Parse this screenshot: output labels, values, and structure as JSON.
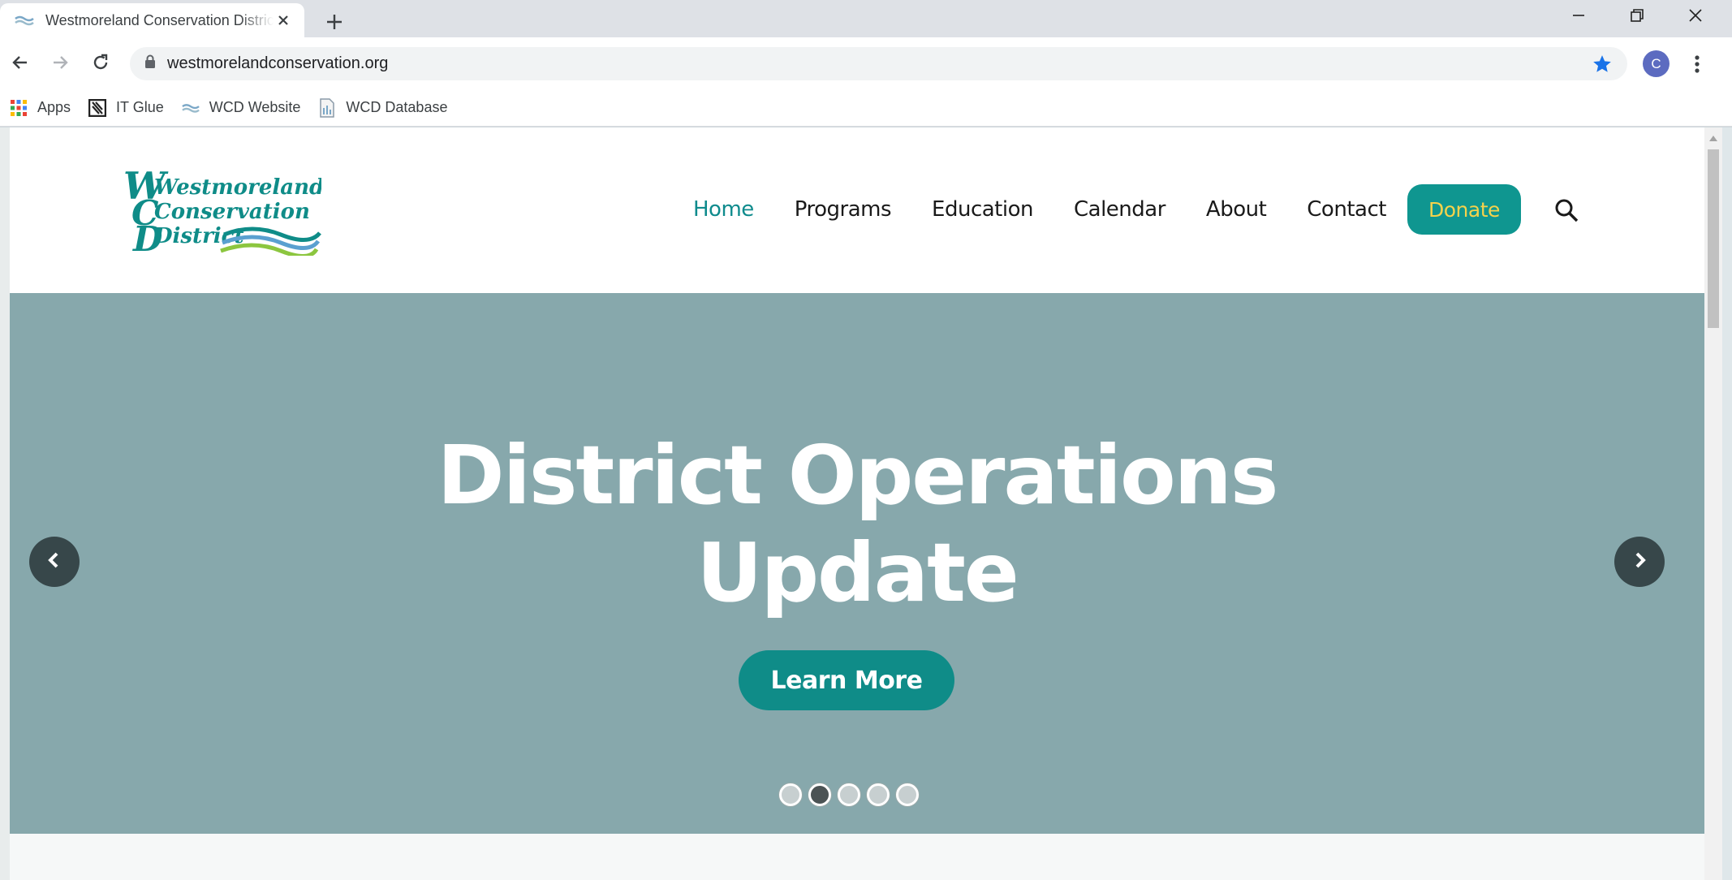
{
  "browser": {
    "tab_title": "Westmoreland Conservation District",
    "url": "westmorelandconservation.org",
    "profile_initial": "C",
    "bookmarks": [
      {
        "label": "Apps",
        "icon": "apps-grid-icon"
      },
      {
        "label": "IT Glue",
        "icon": "it-glue-icon"
      },
      {
        "label": "WCD Website",
        "icon": "wcd-favicon"
      },
      {
        "label": "WCD Database",
        "icon": "document-icon"
      }
    ]
  },
  "site": {
    "logo_lines": [
      "Westmoreland",
      "Conservation",
      "District"
    ],
    "nav": [
      {
        "label": "Home",
        "active": true
      },
      {
        "label": "Programs"
      },
      {
        "label": "Education"
      },
      {
        "label": "Calendar"
      },
      {
        "label": "About"
      },
      {
        "label": "Contact"
      }
    ],
    "donate_label": "Donate",
    "colors": {
      "teal": "#0f8c88",
      "donate_text": "#f5d24b",
      "hero_bg": "#87a8ac"
    }
  },
  "hero": {
    "title_line1": "District Operations",
    "title_line2": "Update",
    "cta_label": "Learn More",
    "slide_count": 5,
    "active_slide": 2
  }
}
